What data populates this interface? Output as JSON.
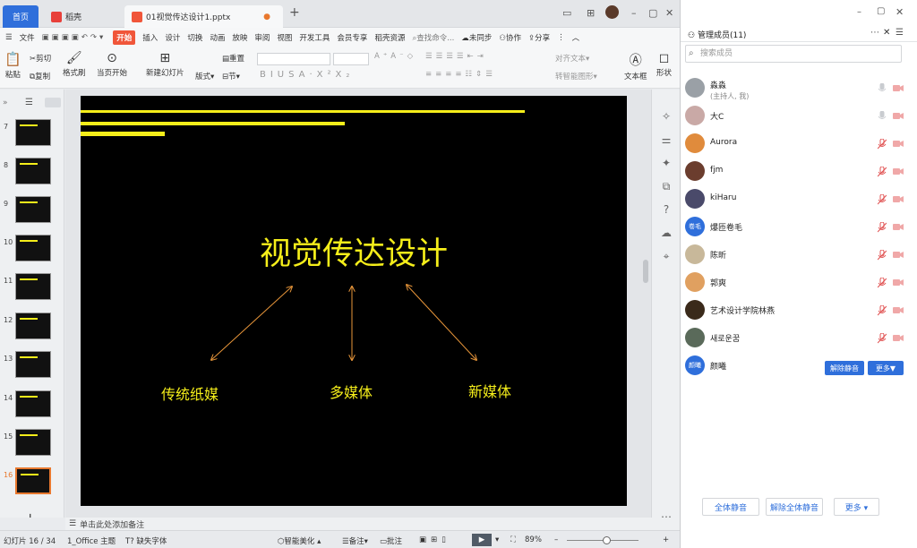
{
  "titlebar": {
    "tab_home": "首页",
    "tab_daoke": "稻壳",
    "tab_file": "01视觉传达设计1.pptx",
    "new_tab": "+"
  },
  "menu": {
    "file": "文件",
    "start": "开始",
    "items": [
      "插入",
      "设计",
      "切换",
      "动画",
      "放映",
      "审阅",
      "视图",
      "开发工具",
      "会员专享",
      "稻壳资源"
    ],
    "search": "查找命令...",
    "unsync": "未同步",
    "collab": "协作",
    "share": "分享"
  },
  "toolbar": {
    "paste": "粘贴",
    "cut": "剪切",
    "copy": "复制",
    "format_painter": "格式刷",
    "from_current": "当页开始",
    "new_slide": "新建幻灯片",
    "layout": "版式",
    "section": "节",
    "reset": "重置",
    "align_text": "对齐文本",
    "smart_graphic": "转智能图形",
    "textbox": "文本框",
    "shape": "形状"
  },
  "thumbnails": {
    "numbers": [
      "7",
      "8",
      "9",
      "10",
      "11",
      "12",
      "13",
      "14",
      "15",
      "16"
    ],
    "selected": "16"
  },
  "slide": {
    "title": "视觉传达设计",
    "label_left": "传统纸媒",
    "label_center": "多媒体",
    "label_right": "新媒体",
    "accent_color": "#f5ee1a",
    "arrow_color": "#e8963a"
  },
  "notes": {
    "placeholder": "单击此处添加备注"
  },
  "statusbar": {
    "slide_count": "幻灯片 16 / 34",
    "theme": "1_Office 主题",
    "missing_font": "缺失字体",
    "beautify": "智能美化",
    "notes": "备注",
    "comments": "批注",
    "zoom": "89%"
  },
  "members": {
    "title": "管理成员(11)",
    "search_placeholder": "搜索成员",
    "list": [
      {
        "name": "淼淼",
        "sub": "(主持人, 我)",
        "avatar_color": "#9aa0a6"
      },
      {
        "name": "大C",
        "sub": "",
        "avatar_color": "#c9a9a6"
      },
      {
        "name": "Aurora",
        "sub": "",
        "avatar_color": "#e08b3c"
      },
      {
        "name": "fjm",
        "sub": "",
        "avatar_color": "#6b3d2e"
      },
      {
        "name": "kiHaru",
        "sub": "",
        "avatar_color": "#4a4a6a"
      },
      {
        "name": "爆匝卷毛",
        "sub": "",
        "avatar_color": "#2f6fdb",
        "avatar_text": "卷毛"
      },
      {
        "name": "陈昕",
        "sub": "",
        "avatar_color": "#c8b89a"
      },
      {
        "name": "郭爽",
        "sub": "",
        "avatar_color": "#e0a060"
      },
      {
        "name": "艺术设计学院林燕",
        "sub": "",
        "avatar_color": "#3a2a1a"
      },
      {
        "name": "새로운꿈",
        "sub": "",
        "avatar_color": "#5a6a5a"
      },
      {
        "name": "颜曦",
        "sub": "",
        "avatar_color": "#2f6fdb",
        "avatar_text": "颜曦"
      }
    ],
    "unmute_label": "解除静音",
    "more_label": "更多▼",
    "mute_all": "全体静音",
    "unmute_all": "解除全体静音",
    "more_bottom": "更多 ▾"
  },
  "colors": {
    "accent_blue": "#2f6fdb",
    "wps_red": "#f0563a",
    "muted_red": "#e05050"
  }
}
